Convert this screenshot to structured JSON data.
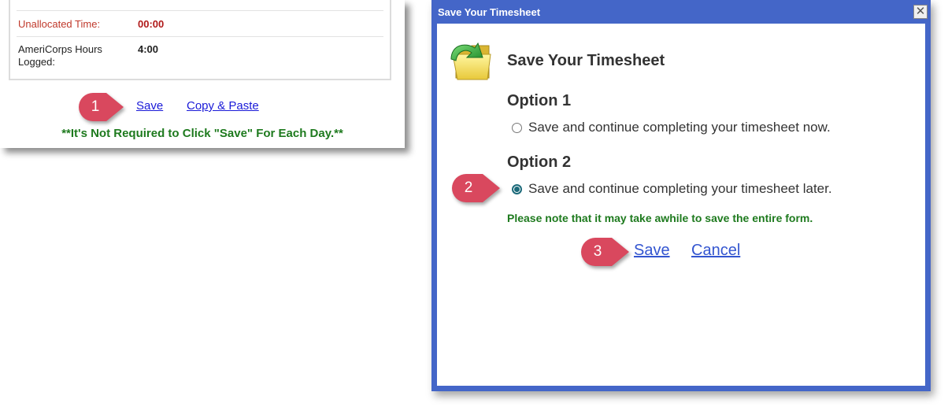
{
  "timesheet": {
    "unallocated_label": "Unallocated Time:",
    "unallocated_value": "00:00",
    "americorps_label": "AmeriCorps Hours Logged:",
    "americorps_value": "4:00",
    "save_link": "Save",
    "copy_paste_link": "Copy & Paste",
    "note": "**It's Not Required to Click \"Save\" For Each Day.**"
  },
  "callouts": [
    "1",
    "2",
    "3"
  ],
  "dialog": {
    "title_bar": "Save Your Timesheet",
    "close_symbol": "✕",
    "heading": "Save Your Timesheet",
    "icon": "folder-arrow-icon",
    "option1": {
      "heading": "Option 1",
      "label": "Save and continue completing your timesheet now.",
      "checked": false
    },
    "option2": {
      "heading": "Option 2",
      "label": "Save and continue completing your timesheet later.",
      "checked": true
    },
    "note": "Please note that it may take awhile to save the entire form.",
    "save_button": "Save",
    "cancel_button": "Cancel"
  },
  "colors": {
    "callout": "#d9485e",
    "dialog_border": "#4466c8",
    "note_green": "#1e7a1e",
    "alert_red": "#c0392b"
  }
}
